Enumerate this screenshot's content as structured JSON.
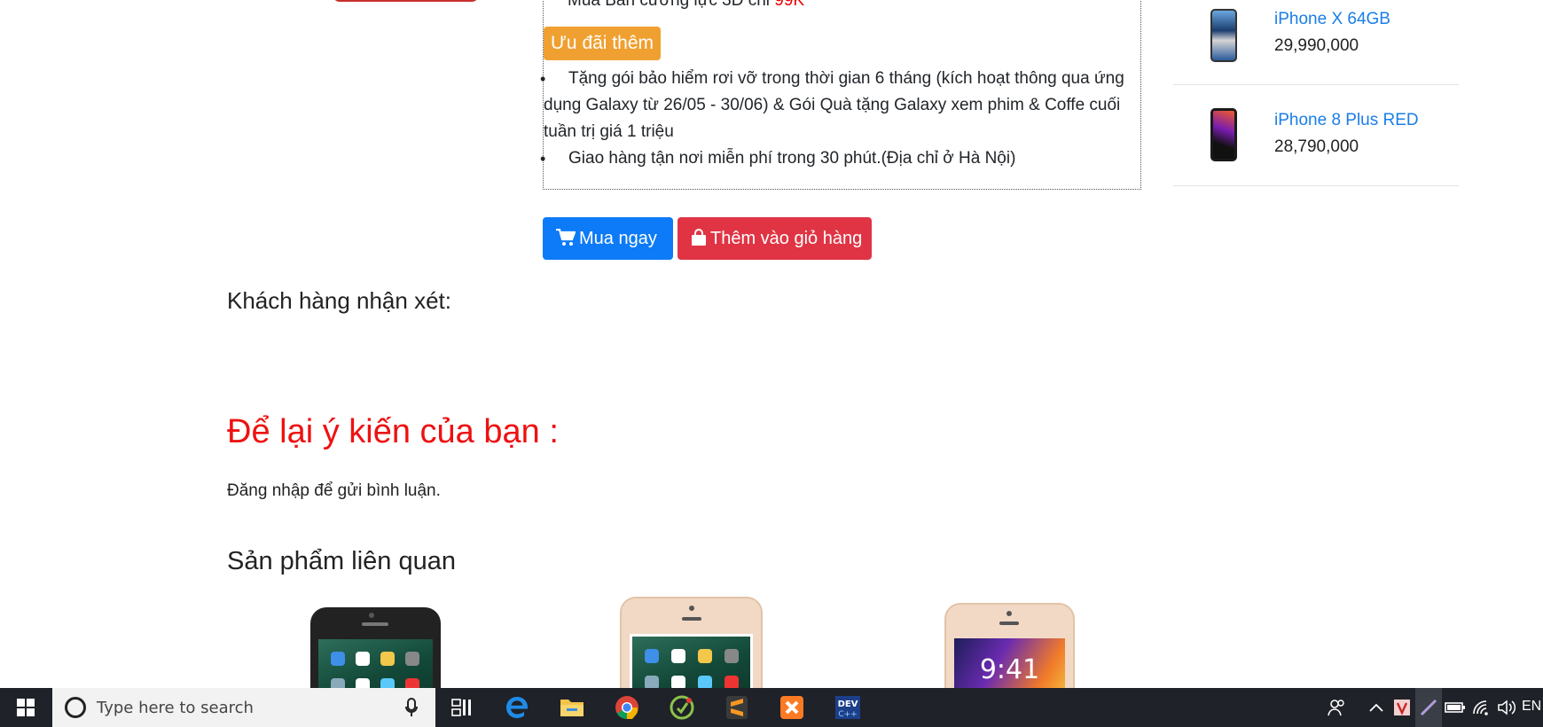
{
  "promo": {
    "cut_line_text": "Mua Bàn cường lực 3D chỉ ",
    "cut_line_price": "99K",
    "badge": "Ưu đãi thêm",
    "items": [
      "Tặng gói bảo hiểm rơi vỡ trong thời gian 6 tháng (kích hoạt thông qua ứng dụng Galaxy từ 26/05 - 30/06) & Gói Quà tặng Galaxy xem phim & Coffe cuối tuần trị giá 1 triệu",
      "Giao hàng tận nơi miễn phí trong 30 phút.(Địa chỉ ở Hà Nội)"
    ]
  },
  "actions": {
    "buy_label": "Mua ngay",
    "cart_label": "Thêm vào giỏ hàng"
  },
  "reviews": {
    "heading": "Khách hàng nhận xét:"
  },
  "comment": {
    "heading": "Để lại ý kiến của bạn :",
    "login_note": "Đăng nhập để gửi bình luận."
  },
  "related": {
    "heading": "Sản phẩm liên quan",
    "phone3_clock": "9:41"
  },
  "sidebar": {
    "items": [
      {
        "name": "iPhone X 64GB",
        "price": "29,990,000"
      },
      {
        "name": "iPhone 8 Plus RED",
        "price": "28,790,000"
      }
    ]
  },
  "taskbar": {
    "search_placeholder": "Type here to search",
    "lang": "EN"
  },
  "colors": {
    "buy_button": "#0d7bf7",
    "cart_button": "#e03444",
    "badge": "#f0a030",
    "comment_heading": "#ee1111",
    "link": "#1a7ee8"
  }
}
